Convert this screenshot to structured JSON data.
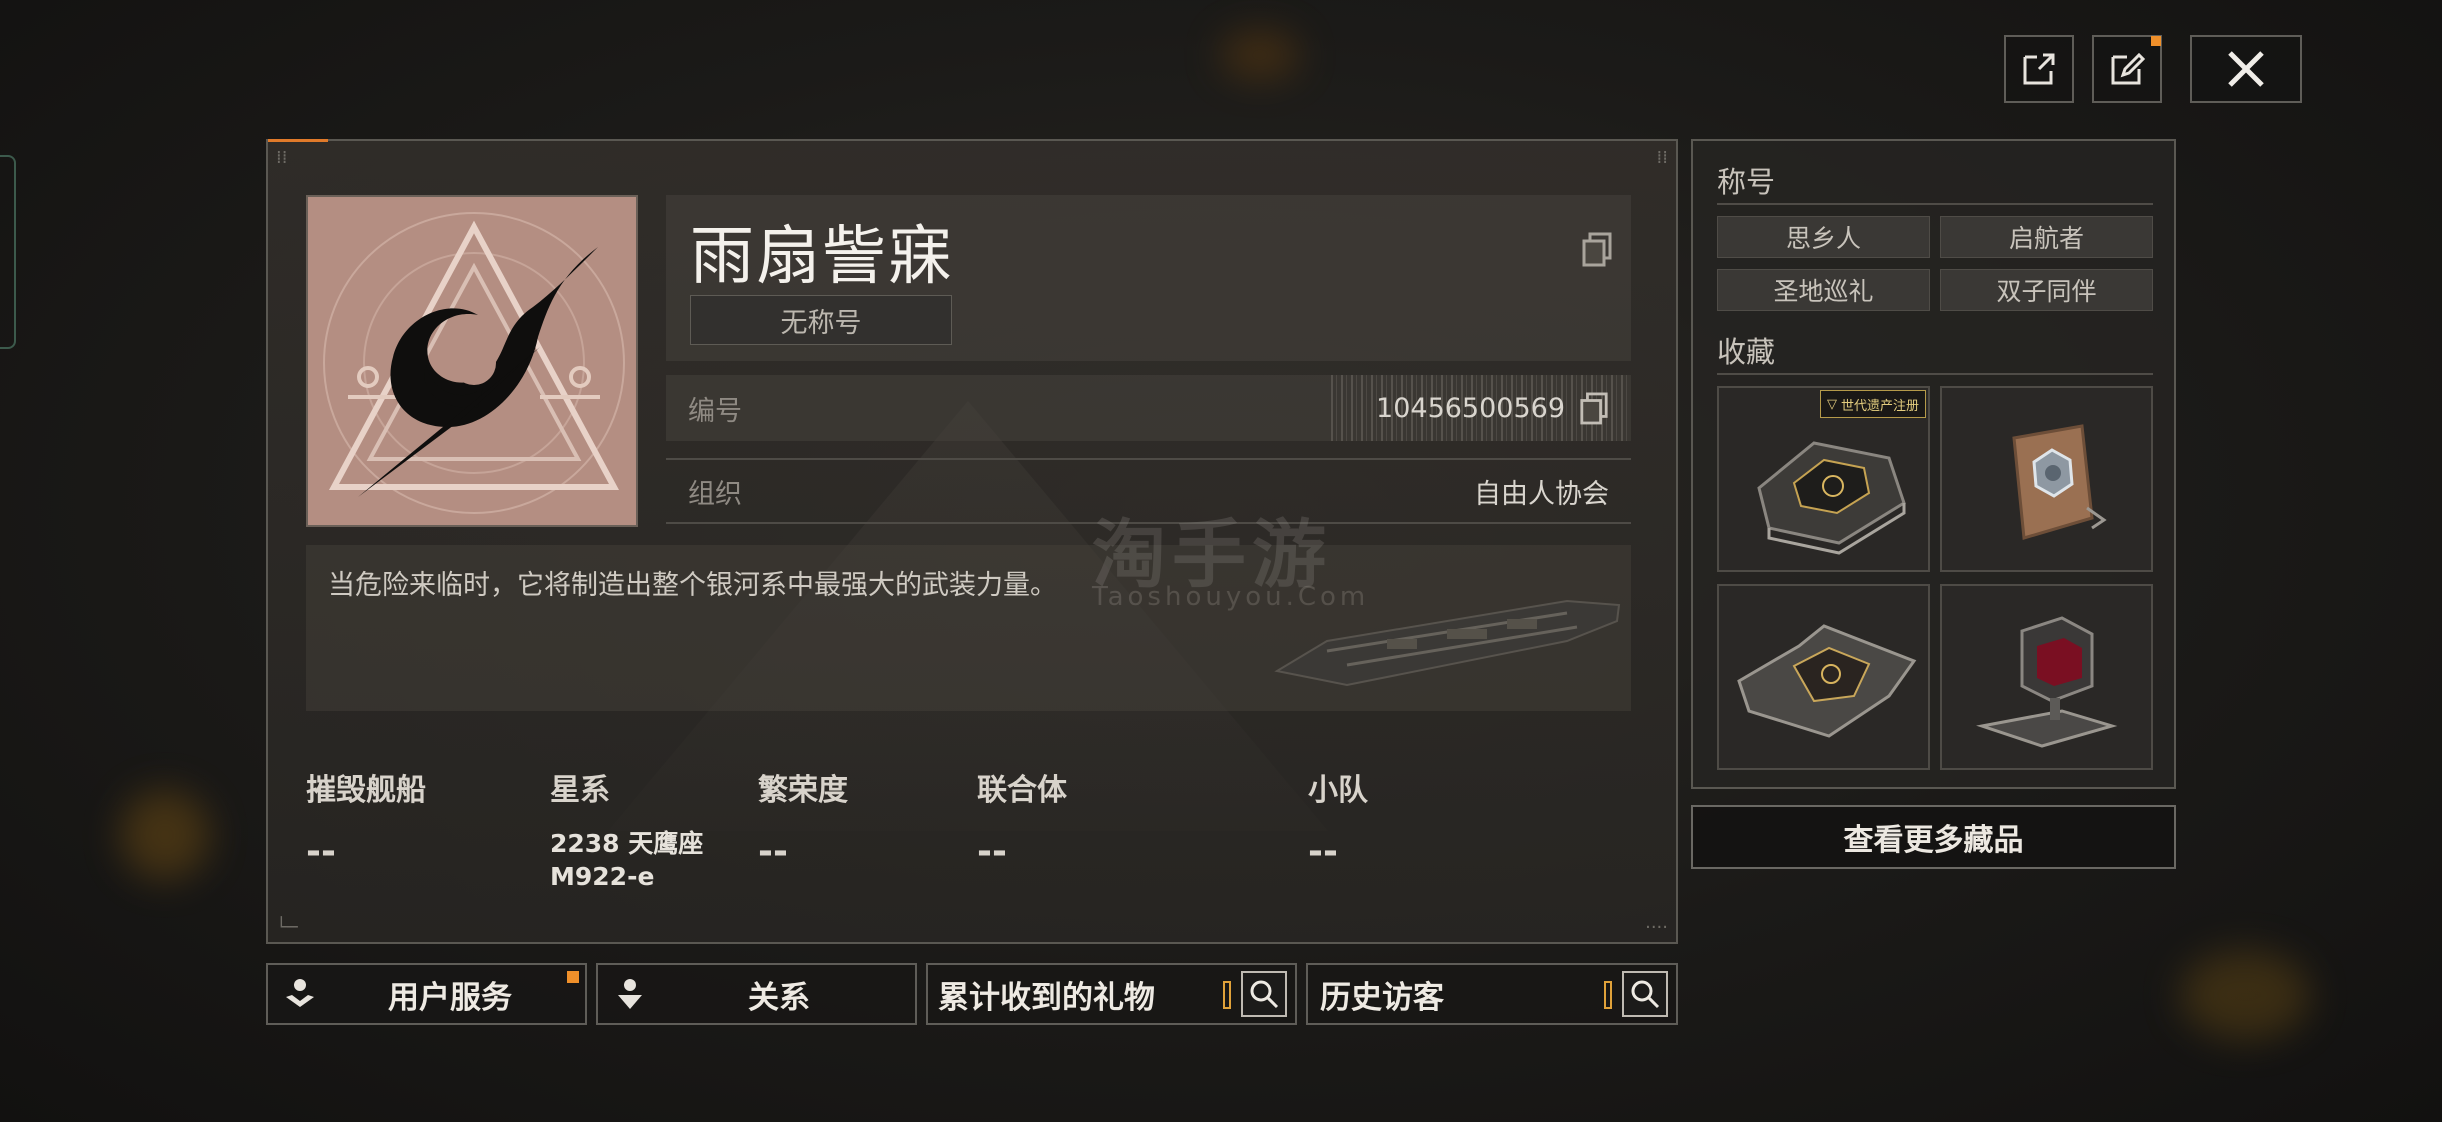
{
  "top_buttons": {
    "share_icon": "share-icon",
    "edit_icon": "edit-icon",
    "close_icon": "close-icon"
  },
  "profile": {
    "name": "雨扇訾寐",
    "title_chip": "无称号",
    "id_label": "编号",
    "id_value": "10456500569",
    "org_label": "组织",
    "org_value": "自由人协会",
    "description": "当危险来临时，它将制造出整个银河系中最强大的武装力量。"
  },
  "watermark": {
    "main": "淘手游",
    "sub": "Taoshouyou.Com"
  },
  "stats": [
    {
      "label": "摧毁舰船",
      "value": "--"
    },
    {
      "label": "星系",
      "value_line1": "2238 天鹰座",
      "value_line2": "M922-e"
    },
    {
      "label": "繁荣度",
      "value": "--"
    },
    {
      "label": "联合体",
      "value": "--"
    },
    {
      "label": "小队",
      "value": "--"
    }
  ],
  "side": {
    "titles_heading": "称号",
    "titles": [
      "思乡人",
      "启航者",
      "圣地巡礼",
      "双子同伴"
    ],
    "collection_heading": "收藏",
    "collection_badge": "世代遗产注册",
    "more_button": "查看更多藏品"
  },
  "bottom": {
    "user_service": "用户服务",
    "relations": "关系",
    "gifts": "累计收到的礼物",
    "visitors": "历史访客"
  },
  "colors": {
    "accent_orange": "#f0902a",
    "gold": "#e0a23a",
    "avatar_bg": "#b48e82"
  }
}
